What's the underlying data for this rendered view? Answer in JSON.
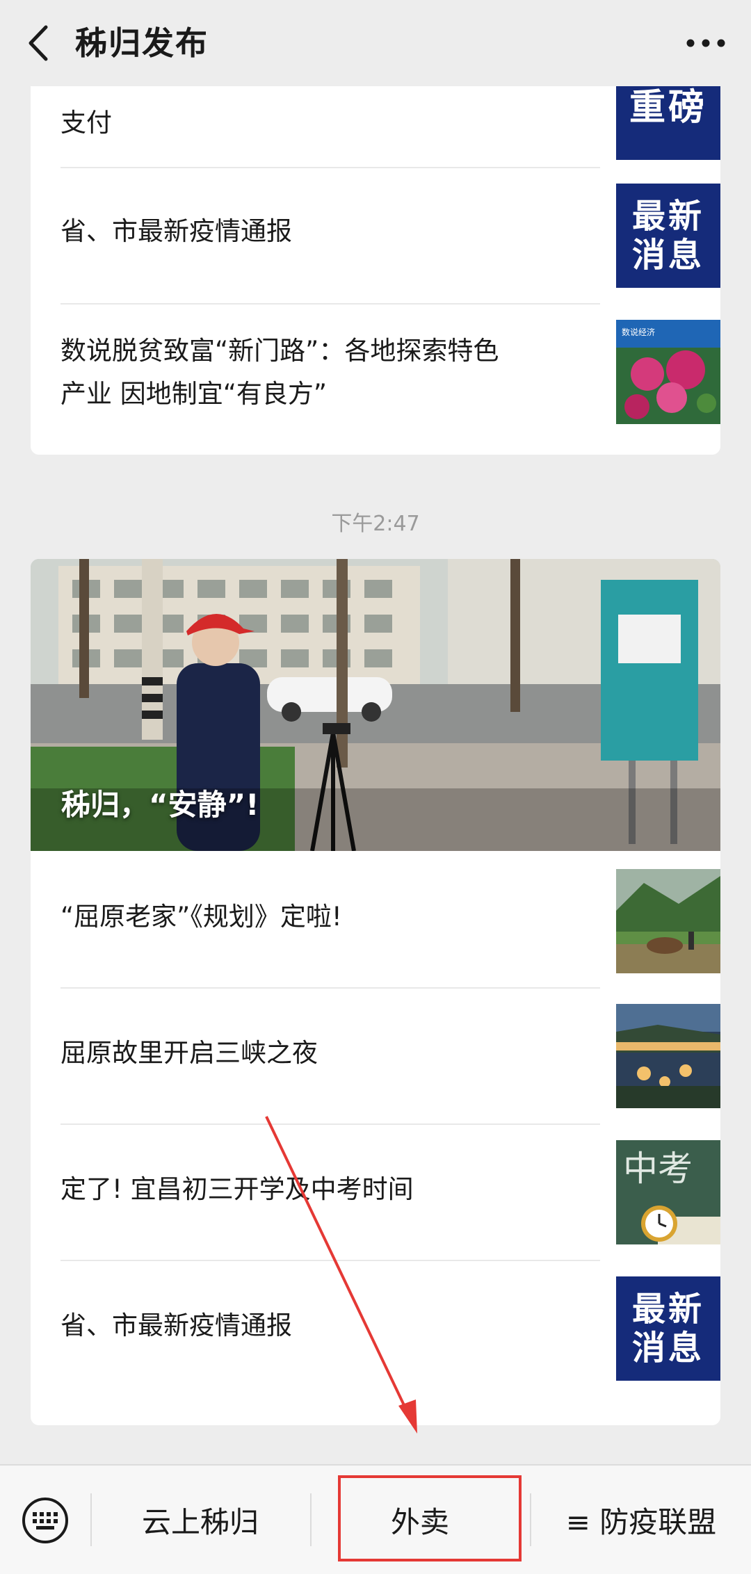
{
  "header": {
    "title": "秭归发布",
    "back_icon": "chevron-left-icon",
    "more_icon": "more-horizontal-icon"
  },
  "card1": {
    "items": [
      {
        "title_partial": "支付",
        "thumb_text": "重磅"
      },
      {
        "title": "省、市最新疫情通报",
        "thumb_line1": "最新",
        "thumb_line2": "消息"
      },
      {
        "title_line1": "数说脱贫致富“新门路”：各地探索特色",
        "title_line2": "产业 因地制宜“有良方”",
        "thumb_badge": "数说经济"
      }
    ]
  },
  "timestamp": "下午2:47",
  "card2": {
    "hero_caption": "秭归，“安静”!",
    "items": [
      {
        "title": "“屈原老家”《规划》定啦!"
      },
      {
        "title": "屈原故里开启三峡之夜"
      },
      {
        "title": "定了! 宜昌初三开学及中考时间",
        "thumb_text": "中考"
      },
      {
        "title": "省、市最新疫情通报",
        "thumb_line1": "最新",
        "thumb_line2": "消息"
      }
    ]
  },
  "bottom_menu": {
    "keyboard_icon": "keyboard-icon",
    "items": [
      {
        "label": "云上秭归"
      },
      {
        "label": "外卖"
      },
      {
        "label": "≡ 防疫联盟"
      }
    ]
  },
  "colors": {
    "annotation_red": "#e53935",
    "news_thumb_blue": "#152b7a"
  }
}
